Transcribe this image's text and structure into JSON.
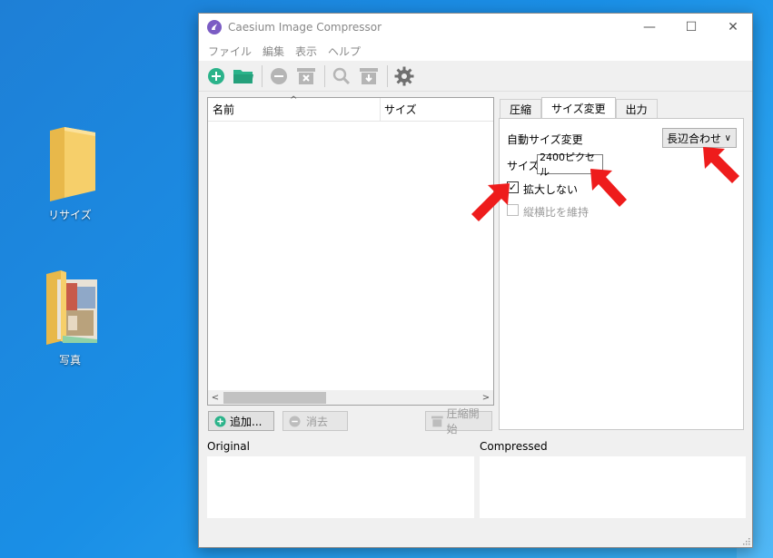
{
  "desktop": {
    "icons": [
      {
        "label": "リサイズ"
      },
      {
        "label": "写真"
      }
    ]
  },
  "window": {
    "title": "Caesium Image Compressor",
    "controls": {
      "minimize": "—",
      "maximize": "☐",
      "close": "✕"
    }
  },
  "menu": [
    "ファイル",
    "編集",
    "表示",
    "ヘルプ"
  ],
  "file_list": {
    "columns": [
      "名前",
      "サイズ"
    ],
    "sort_indicator": "^"
  },
  "list_buttons": {
    "add": "追加...",
    "clear": "消去",
    "compress": "圧縮開始"
  },
  "tabs": [
    "圧縮",
    "サイズ変更",
    "出力"
  ],
  "resize": {
    "auto_resize_label": "自動サイズ変更",
    "mode_value": "長辺合わせ",
    "size_label": "サイズ",
    "size_value": "2400ピクセル",
    "no_enlarge_label": "拡大しない",
    "no_enlarge_checked": true,
    "keep_aspect_label": "縦横比を維持",
    "keep_aspect_checked": false
  },
  "previews": {
    "original_label": "Original",
    "compressed_label": "Compressed"
  },
  "colors": {
    "accent_green": "#2bb38a",
    "annotation_red": "#ee1c1c",
    "app_purple": "#7b5cc4"
  }
}
